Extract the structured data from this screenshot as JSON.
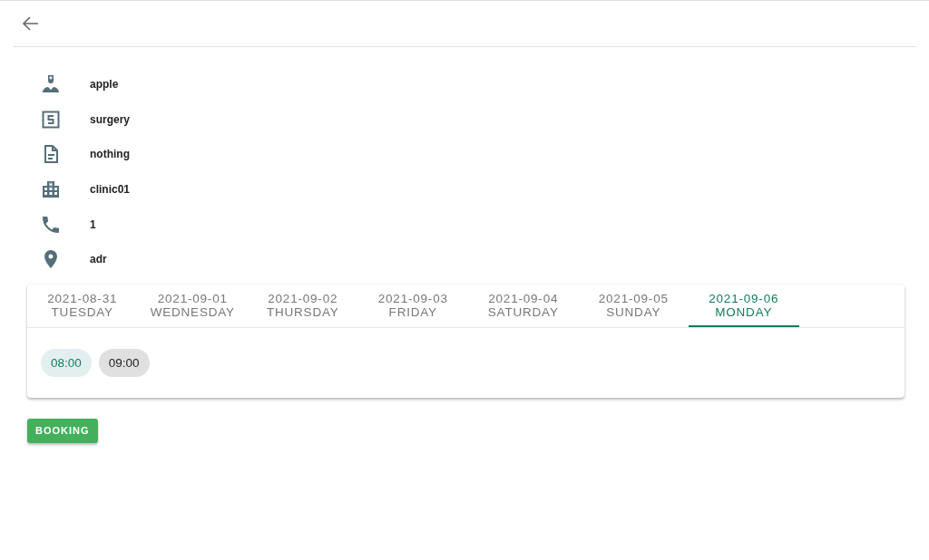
{
  "info": [
    {
      "kind": "doctor",
      "text": "apple"
    },
    {
      "kind": "specialty",
      "text": "surgery"
    },
    {
      "kind": "note",
      "text": "nothing"
    },
    {
      "kind": "clinic",
      "text": "clinic01"
    },
    {
      "kind": "phone",
      "text": "1"
    },
    {
      "kind": "address",
      "text": "adr"
    }
  ],
  "tabs": [
    {
      "date": "2021-08-31",
      "day": "TUESDAY",
      "selected": false
    },
    {
      "date": "2021-09-01",
      "day": "WEDNESDAY",
      "selected": false
    },
    {
      "date": "2021-09-02",
      "day": "THURSDAY",
      "selected": false
    },
    {
      "date": "2021-09-03",
      "day": "FRIDAY",
      "selected": false
    },
    {
      "date": "2021-09-04",
      "day": "SATURDAY",
      "selected": false
    },
    {
      "date": "2021-09-05",
      "day": "SUNDAY",
      "selected": false
    },
    {
      "date": "2021-09-06",
      "day": "MONDAY",
      "selected": true
    }
  ],
  "slots": [
    {
      "time": "08:00",
      "selected": true
    },
    {
      "time": "09:00",
      "selected": false
    }
  ],
  "booking_button": "BOOKING"
}
